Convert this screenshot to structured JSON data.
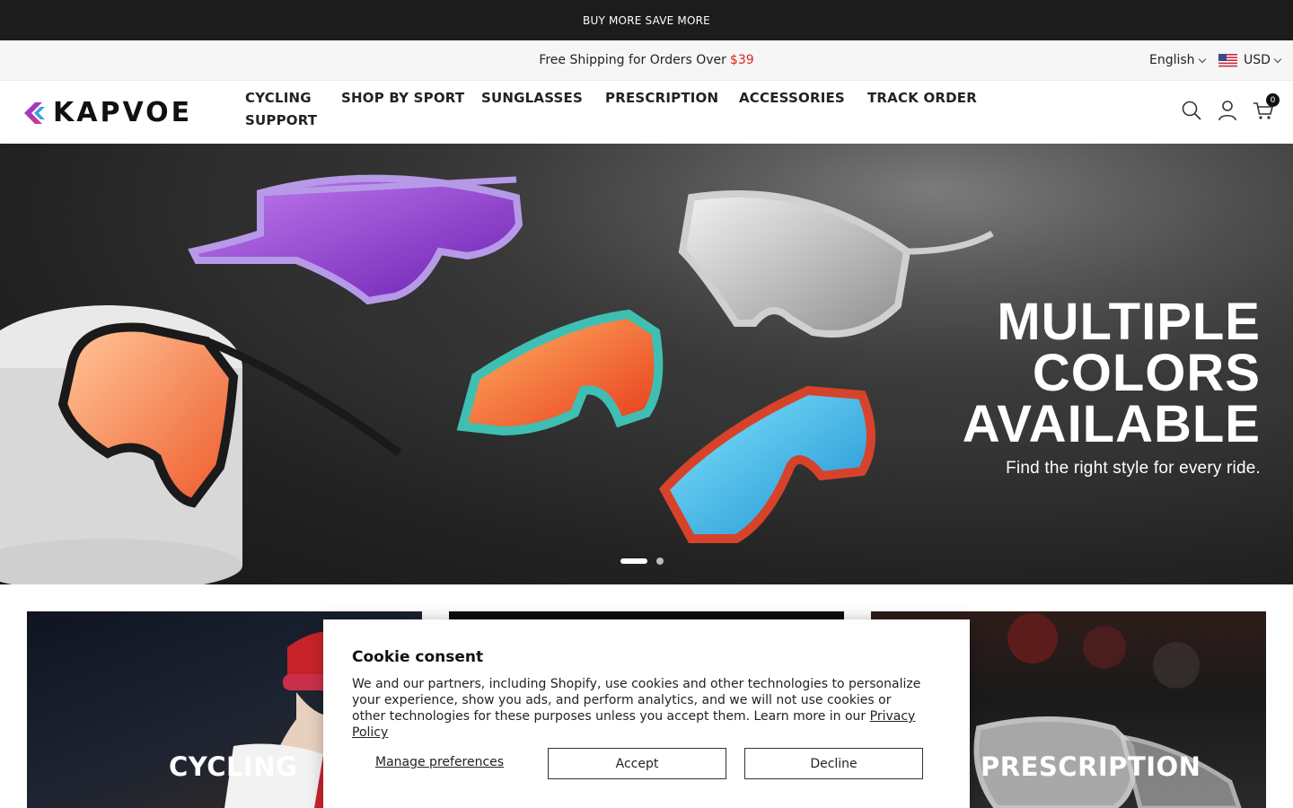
{
  "announcement": {
    "text": "BUY MORE SAVE MORE"
  },
  "topbar": {
    "shipping_text": "Free Shipping for Orders Over",
    "shipping_price": "$39",
    "language": "English",
    "currency": "USD"
  },
  "header": {
    "logo_text": "KAPVOE",
    "nav": [
      "CYCLING",
      "SHOP BY SPORT",
      "SUNGLASSES",
      "PRESCRIPTION",
      "ACCESSORIES",
      "TRACK ORDER",
      "SUPPORT"
    ],
    "cart_count": "0"
  },
  "hero": {
    "title_line1": "MULTIPLE",
    "title_line2": "COLORS",
    "title_line3": "AVAILABLE",
    "subtitle": "Find the right style for every ride.",
    "slides_total": 2,
    "active_slide": 1
  },
  "categories": [
    {
      "label": "CYCLING"
    },
    {
      "label": ""
    },
    {
      "label": "PRESCRIPTION"
    }
  ],
  "cookie": {
    "title": "Cookie consent",
    "body": "We and our partners, including Shopify, use cookies and other technologies to personalize your experience, show you ads, and perform analytics, and we will not use cookies or other technologies for these purposes unless you accept them. Learn more in our",
    "policy_link": "Privacy Policy",
    "manage_label": "Manage preferences",
    "accept_label": "Accept",
    "decline_label": "Decline"
  },
  "colors": {
    "announcement_bg": "#1c1c1c",
    "price_red": "#e0241a",
    "logo_purple": "#6b3fd6",
    "logo_pink": "#e2337a"
  }
}
